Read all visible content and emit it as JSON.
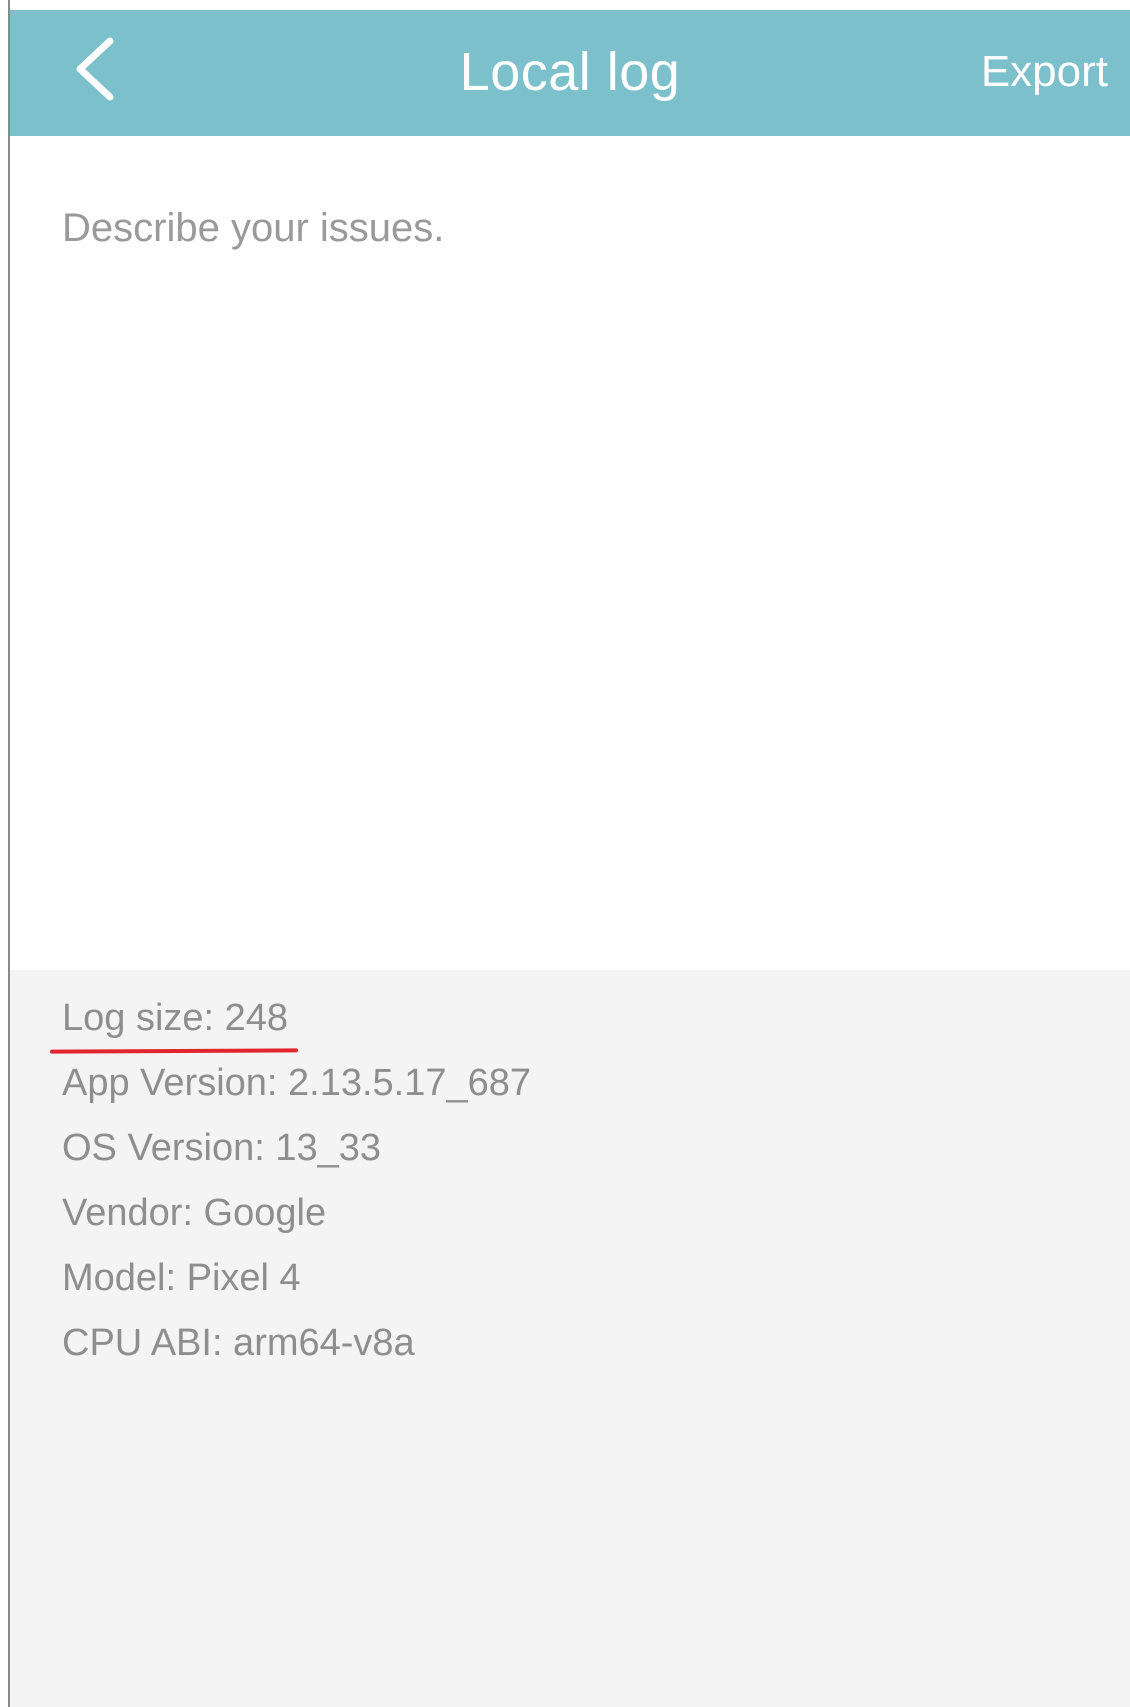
{
  "header": {
    "title": "Local log",
    "export_label": "Export",
    "back_icon": "chevron-left-icon"
  },
  "issue_input": {
    "placeholder": "Describe your issues.",
    "value": ""
  },
  "info": {
    "log_size": "Log size: 248",
    "app_version": "App Version: 2.13.5.17_687",
    "os_version": "OS Version: 13_33",
    "vendor": "Vendor: Google",
    "model": "Model: Pixel 4",
    "cpu_abi": "CPU ABI: arm64-v8a"
  },
  "colors": {
    "header_bg": "#7cc0cc",
    "header_text": "#ffffff",
    "info_bg": "#f4f4f4",
    "info_text": "#8e8e8e",
    "annotation_underline": "#e1262d"
  }
}
